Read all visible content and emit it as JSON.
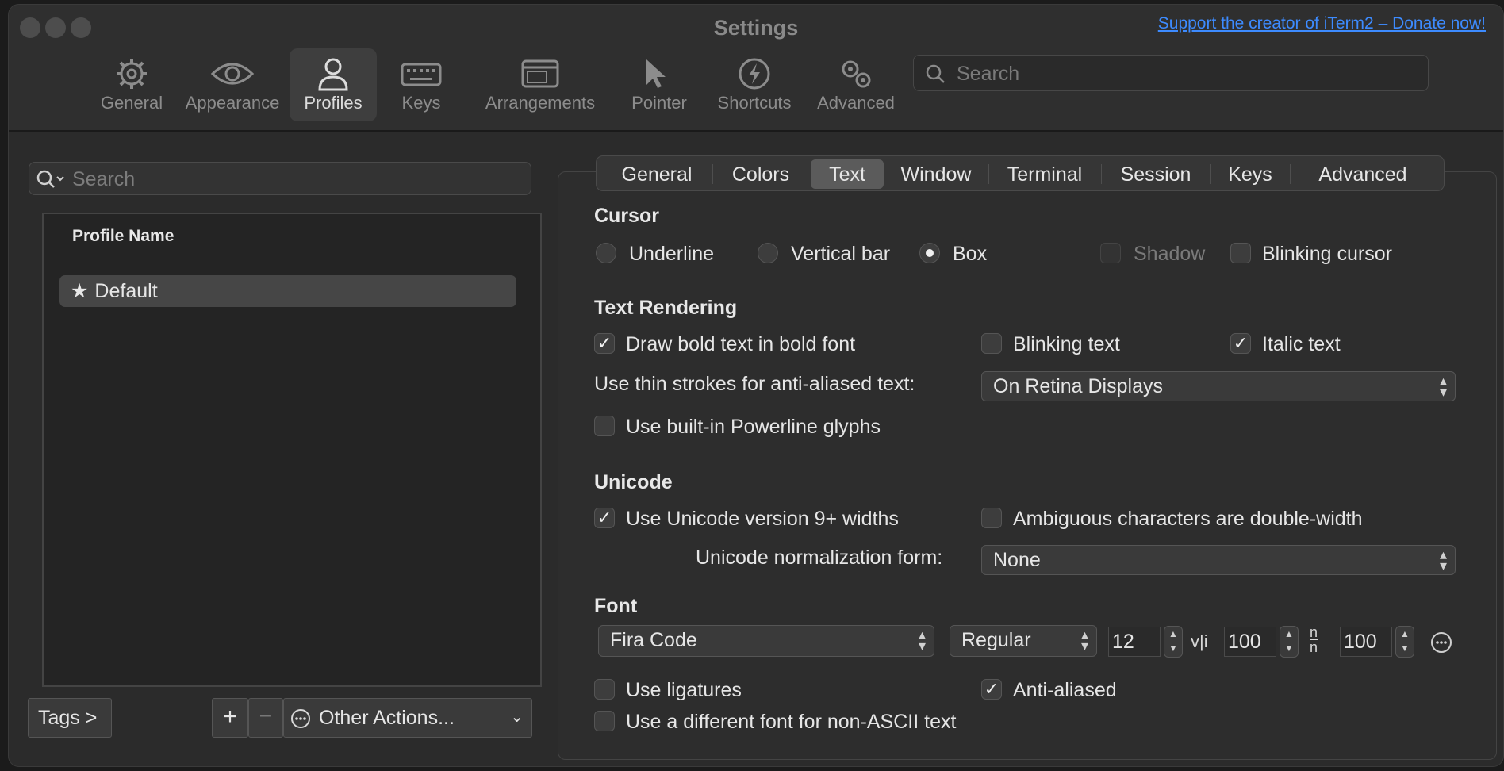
{
  "window": {
    "title": "Settings",
    "donate_link": "Support the creator of iTerm2 – Donate now!"
  },
  "toolbar": {
    "items": [
      {
        "label": "General",
        "icon": "gear-icon"
      },
      {
        "label": "Appearance",
        "icon": "eye-icon"
      },
      {
        "label": "Profiles",
        "icon": "person-icon",
        "active": true
      },
      {
        "label": "Keys",
        "icon": "keyboard-icon"
      },
      {
        "label": "Arrangements",
        "icon": "windows-icon"
      },
      {
        "label": "Pointer",
        "icon": "pointer-icon"
      },
      {
        "label": "Shortcuts",
        "icon": "bolt-icon"
      },
      {
        "label": "Advanced",
        "icon": "gears-icon"
      }
    ],
    "search_placeholder": "Search"
  },
  "profiles": {
    "search_placeholder": "Search",
    "column_header": "Profile Name",
    "rows": [
      {
        "name": "Default",
        "default": true
      }
    ],
    "tags_button": "Tags >",
    "add_button": "+",
    "remove_button": "–",
    "other_actions": "Other Actions..."
  },
  "tabs": {
    "items": [
      "General",
      "Colors",
      "Text",
      "Window",
      "Terminal",
      "Session",
      "Keys",
      "Advanced"
    ],
    "active": "Text"
  },
  "cursor": {
    "heading": "Cursor",
    "underline": "Underline",
    "vertical_bar": "Vertical bar",
    "box": "Box",
    "selected": "Box",
    "shadow": "Shadow",
    "blinking": "Blinking cursor"
  },
  "rendering": {
    "heading": "Text Rendering",
    "bold": "Draw bold text in bold font",
    "bold_checked": true,
    "blinking_text": "Blinking text",
    "blinking_checked": false,
    "italic": "Italic text",
    "italic_checked": true,
    "thin_strokes_label": "Use thin strokes for anti-aliased text:",
    "thin_strokes_value": "On Retina Displays",
    "powerline": "Use built-in Powerline glyphs",
    "powerline_checked": false
  },
  "unicode": {
    "heading": "Unicode",
    "v9_widths": "Use Unicode version 9+ widths",
    "v9_checked": true,
    "ambiguous": "Ambiguous characters are double-width",
    "ambiguous_checked": false,
    "normalization_label": "Unicode normalization form:",
    "normalization_value": "None"
  },
  "font": {
    "heading": "Font",
    "family": "Fira Code",
    "weight": "Regular",
    "size": "12",
    "vertical_spacing_icon": "v|i",
    "vertical_spacing": "100",
    "horizontal_spacing_icon": "n/n",
    "horizontal_spacing": "100",
    "ligatures": "Use ligatures",
    "ligatures_checked": false,
    "anti_aliased": "Anti-aliased",
    "anti_aliased_checked": true,
    "non_ascii": "Use a different font for non-ASCII text",
    "non_ascii_checked": false
  }
}
